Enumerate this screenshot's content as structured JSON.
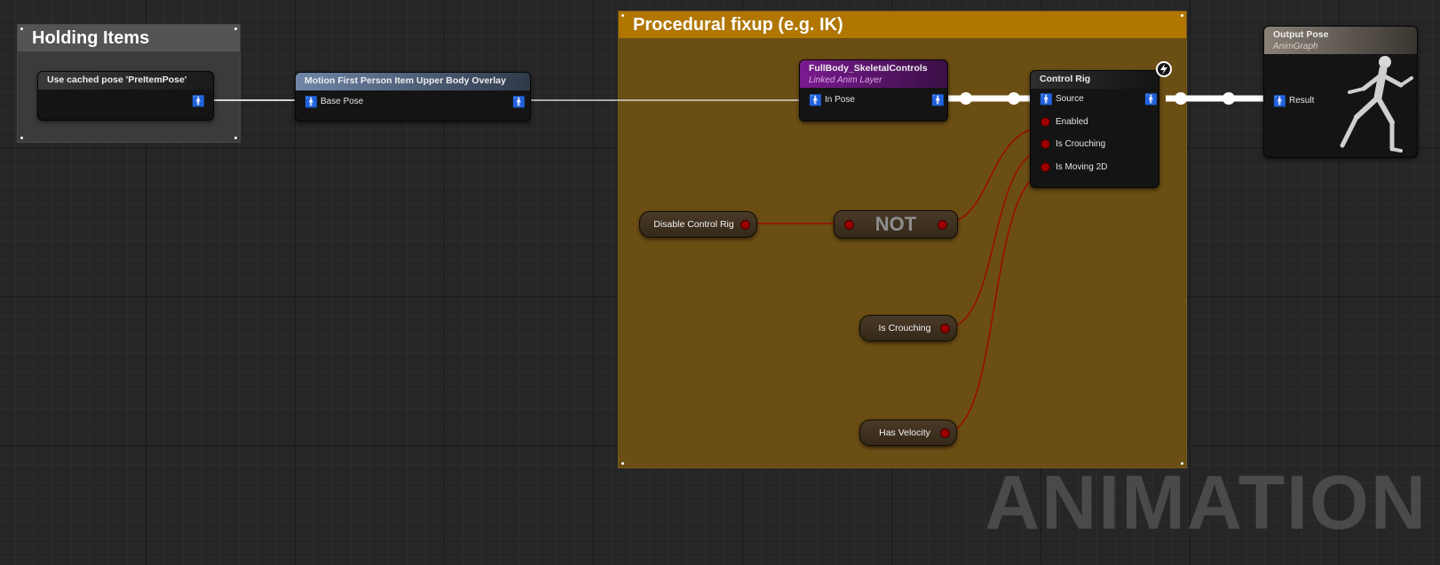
{
  "comments": {
    "holding_items": "Holding Items",
    "procedural": "Procedural fixup (e.g. IK)"
  },
  "nodes": {
    "cached_pose": {
      "title": "Use cached pose 'PreItemPose'"
    },
    "overlay": {
      "title": "Motion First Person Item Upper Body Overlay",
      "pin": "Base Pose"
    },
    "fullbody": {
      "title": "FullBody_SkeletalControls",
      "subtitle": "Linked Anim Layer",
      "pin": "In Pose"
    },
    "control_rig": {
      "title": "Control Rig",
      "pins": [
        "Source",
        "Enabled",
        "Is Crouching",
        "Is Moving 2D"
      ]
    },
    "output_pose": {
      "title": "Output Pose",
      "subtitle": "AnimGraph",
      "pin": "Result"
    },
    "disable_control_rig": "Disable Control Rig",
    "not": "NOT",
    "is_crouching": "Is Crouching",
    "has_velocity": "Has Velocity"
  },
  "watermark": "ANIMATION",
  "colors": {
    "pose_wire": "#ffffff",
    "bool_wire": "#a30000",
    "procedural_comment": "#b07600",
    "holding_comment": "#545454"
  },
  "icons": [
    "pose-pin-icon",
    "fast-path-bolt-icon",
    "mannequin-icon"
  ]
}
